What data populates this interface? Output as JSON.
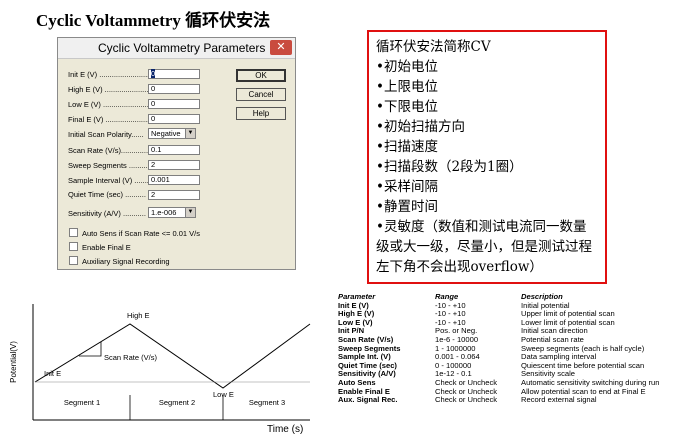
{
  "page_title": "Cyclic Voltammetry 循环伏安法",
  "dialog": {
    "title": "Cyclic Voltammetry Parameters",
    "close_glyph": "✕",
    "fields": [
      {
        "label": "Init E (V) ..........................",
        "value": "0"
      },
      {
        "label": "High E (V) .........................",
        "value": "0"
      },
      {
        "label": "Low E (V) ..........................",
        "value": "0"
      },
      {
        "label": "Final E (V) .........................",
        "value": "0"
      }
    ],
    "polarity_label": "Initial Scan Polarity......",
    "polarity_value": "Negative",
    "fields2": [
      {
        "label": "Scan Rate (V/s).............",
        "value": "0.1"
      },
      {
        "label": "Sweep Segments ............",
        "value": "2"
      },
      {
        "label": "Sample Interval (V) .......",
        "value": "0.001"
      },
      {
        "label": "Quiet Time (sec) ..........",
        "value": "2"
      }
    ],
    "sensitivity_label": "Sensitivity (A/V) ...........",
    "sensitivity_value": "1.e-006",
    "buttons": {
      "ok": "OK",
      "cancel": "Cancel",
      "help": "Help"
    },
    "checkboxes": [
      "Auto Sens if Scan Rate <= 0.01 V/s",
      "Enable Final E",
      "Auxiliary Signal Recording"
    ]
  },
  "notes": [
    "循环伏安法简称CV",
    "•初始电位",
    "•上限电位",
    "•下限电位",
    "•初始扫描方向",
    "•扫描速度",
    "•扫描段数（2段为1圈）",
    "•采样间隔",
    "•静置时间",
    "•灵敏度（数值和测试电流同一数量级或大一级，尽量小，但是测试过程左下角不会出现overflow）"
  ],
  "chart": {
    "ylabel": "Potential(V)",
    "xlabel": "Time (s)",
    "high_e": "High E",
    "low_e": "Low E",
    "init_e": "Init E",
    "scan_rate": "Scan Rate (V/s)",
    "segments": [
      "Segment 1",
      "Segment 2",
      "Segment 3"
    ]
  },
  "param_table": {
    "headers": [
      "Parameter",
      "Range",
      "Description"
    ],
    "rows": [
      [
        "Init E (V)",
        "-10   -   +10",
        "Initial potential"
      ],
      [
        "High E (V)",
        "-10   -   +10",
        "Upper limit of potential scan"
      ],
      [
        "Low E (V)",
        "-10   -   +10",
        "Lower limit of potential scan"
      ],
      [
        "Init P/N",
        "Pos. or Neg.",
        "Initial scan direction"
      ],
      [
        "Scan Rate (V/s)",
        "1e-6   -   10000",
        "Potential scan rate"
      ],
      [
        "Sweep Segments",
        "1   -   1000000",
        "Sweep segments (each is half cycle)"
      ],
      [
        "Sample Int. (V)",
        "0.001   -   0.064",
        "Data sampling interval"
      ],
      [
        "Quiet Time (sec)",
        "0   -   100000",
        "Quiescent time before potential scan"
      ],
      [
        "Sensitivity (A/V)",
        "1e-12   -   0.1",
        "Sensitivity scale"
      ],
      [
        "Auto Sens",
        "Check or Uncheck",
        "Automatic sensitivity switching during run"
      ],
      [
        "Enable Final E",
        "Check or Uncheck",
        "Allow potential scan to end at Final E"
      ],
      [
        "Aux. Signal Rec.",
        "Check or Uncheck",
        "Record external signal"
      ]
    ]
  }
}
